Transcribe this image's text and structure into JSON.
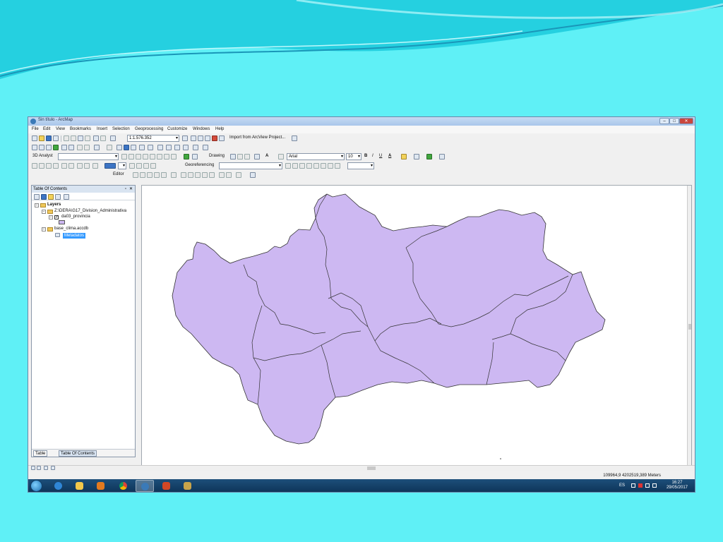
{
  "window": {
    "title": "Sin título - ArcMap"
  },
  "menu": [
    "File",
    "Edit",
    "View",
    "Bookmarks",
    "Insert",
    "Selection",
    "Geoprocessing",
    "Customize",
    "Windows",
    "Help"
  ],
  "toolbar": {
    "scale": "1:1.576.352",
    "import_label": "Import from ArcView Project...",
    "analyst_label": "3D Analyst",
    "drawing_label": "Drawing",
    "font_name": "Arial",
    "font_size": "10",
    "bold": "B",
    "italic": "I",
    "underline": "U",
    "font_color_glyph": "A",
    "georef_label": "Georeferencing",
    "editor_label": "Editor"
  },
  "toc": {
    "title": "Table Of Contents",
    "root": "Layers",
    "group1": "Z:\\DERA\\G17_Division_Administrativa",
    "layer": "da03_provincia",
    "group2": "base_clima.accdb",
    "table": "Metadatos",
    "tab_table": "Table",
    "tab_toc": "Table Of Contents"
  },
  "map": {
    "fill_color": "#cdb8f2",
    "stroke_color": "#333333"
  },
  "status": {
    "coords": "109964,9  4202519,389 Meters"
  },
  "taskbar": {
    "lang": "ES",
    "time": "16:27",
    "date": "29/05/2017"
  },
  "colors": {
    "slide_bg": "#5ff0f6",
    "wave": "#1ec9dc",
    "taskbar": "#1d4f7a"
  }
}
